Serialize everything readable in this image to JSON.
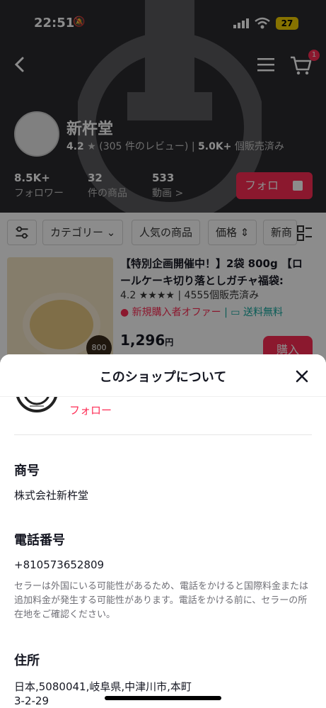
{
  "status": {
    "time": "22:51",
    "battery": "27"
  },
  "header": {
    "cart_count": "1"
  },
  "shop": {
    "name": "新杵堂",
    "rating": "4.2",
    "reviews": "(305 件のレビュー)",
    "sold": "5.0K+",
    "sold_label": "個販売済み",
    "followers": "8.5K+",
    "followers_label": "フォロワー",
    "products": "32",
    "products_label": "件の商品",
    "videos": "533",
    "videos_label": "動画 >",
    "follow_label": "フォロ"
  },
  "filters": [
    "カテゴリー",
    "人気の商品",
    "価格",
    "新商"
  ],
  "product": {
    "title": "【特別企画開催中！】2袋 800g 【ロールケーキ切り落としガチャ福袋:（商…",
    "rating": "4.2",
    "stars": "★★★★",
    "sold": "4555個販売済み",
    "offer": "新規購入者オファー",
    "shipping": "送料無料",
    "price": "1,296",
    "currency": "円",
    "image_tag": "800",
    "buy_label": "購入"
  },
  "sheet": {
    "title": "このショップについて",
    "follow_label": "フォロー",
    "company_label": "商号",
    "company_value": "株式会社新杵堂",
    "phone_label": "電話番号",
    "phone_value": "+810573652809",
    "phone_note": "セラーは外国にいる可能性があるため、電話をかけると国際料金または追加料金が発生する可能性があります。電話をかける前に、セラーの所在地をご確認ください。",
    "address_label": "住所",
    "address_line1": "日本,5080041,岐阜県,中津川市,本町",
    "address_line2": "3-2-29"
  }
}
